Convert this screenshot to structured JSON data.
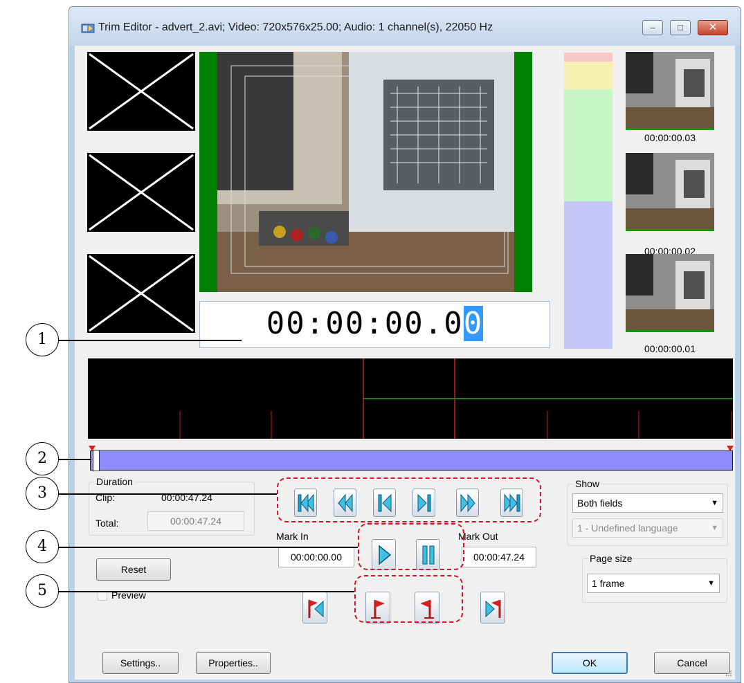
{
  "window": {
    "title": "Trim Editor - advert_2.avi; Video: 720x576x25.00; Audio: 1 channel(s), 22050 Hz",
    "minimize_label": "–",
    "maximize_label": "□",
    "close_label": "✕",
    "icon": "trim-editor-app-icon"
  },
  "timecode": {
    "main_prefix": "00:00:00.0",
    "main_caret_digit": "0"
  },
  "thumbnails": [
    {
      "time": "00:00:00.03"
    },
    {
      "time": "00:00:00.02"
    },
    {
      "time": "00:00:00.01"
    }
  ],
  "duration": {
    "legend": "Duration",
    "clip_label": "Clip:",
    "clip_value": "00:00:47.24",
    "total_label": "Total:",
    "total_value": "00:00:47.24"
  },
  "reset_label": "Reset",
  "preview_label": "Preview",
  "mark_in": {
    "label": "Mark In",
    "value": "00:00:00.00"
  },
  "mark_out": {
    "label": "Mark Out",
    "value": "00:00:47.24"
  },
  "show": {
    "legend": "Show",
    "fields_value": "Both fields",
    "language_value": "1 - Undefined language"
  },
  "page_size": {
    "legend": "Page size",
    "value": "1 frame"
  },
  "bottom_buttons": {
    "settings": "Settings..",
    "properties": "Properties..",
    "ok": "OK",
    "cancel": "Cancel"
  },
  "callouts": [
    "1",
    "2",
    "3",
    "4",
    "5"
  ],
  "colors": {
    "accent_blue": "#3399ff",
    "timeline_bg": "#000000",
    "range_bar": "#8c8cff",
    "highlight_dash": "#d8102a",
    "video_border_green": "#008000"
  }
}
